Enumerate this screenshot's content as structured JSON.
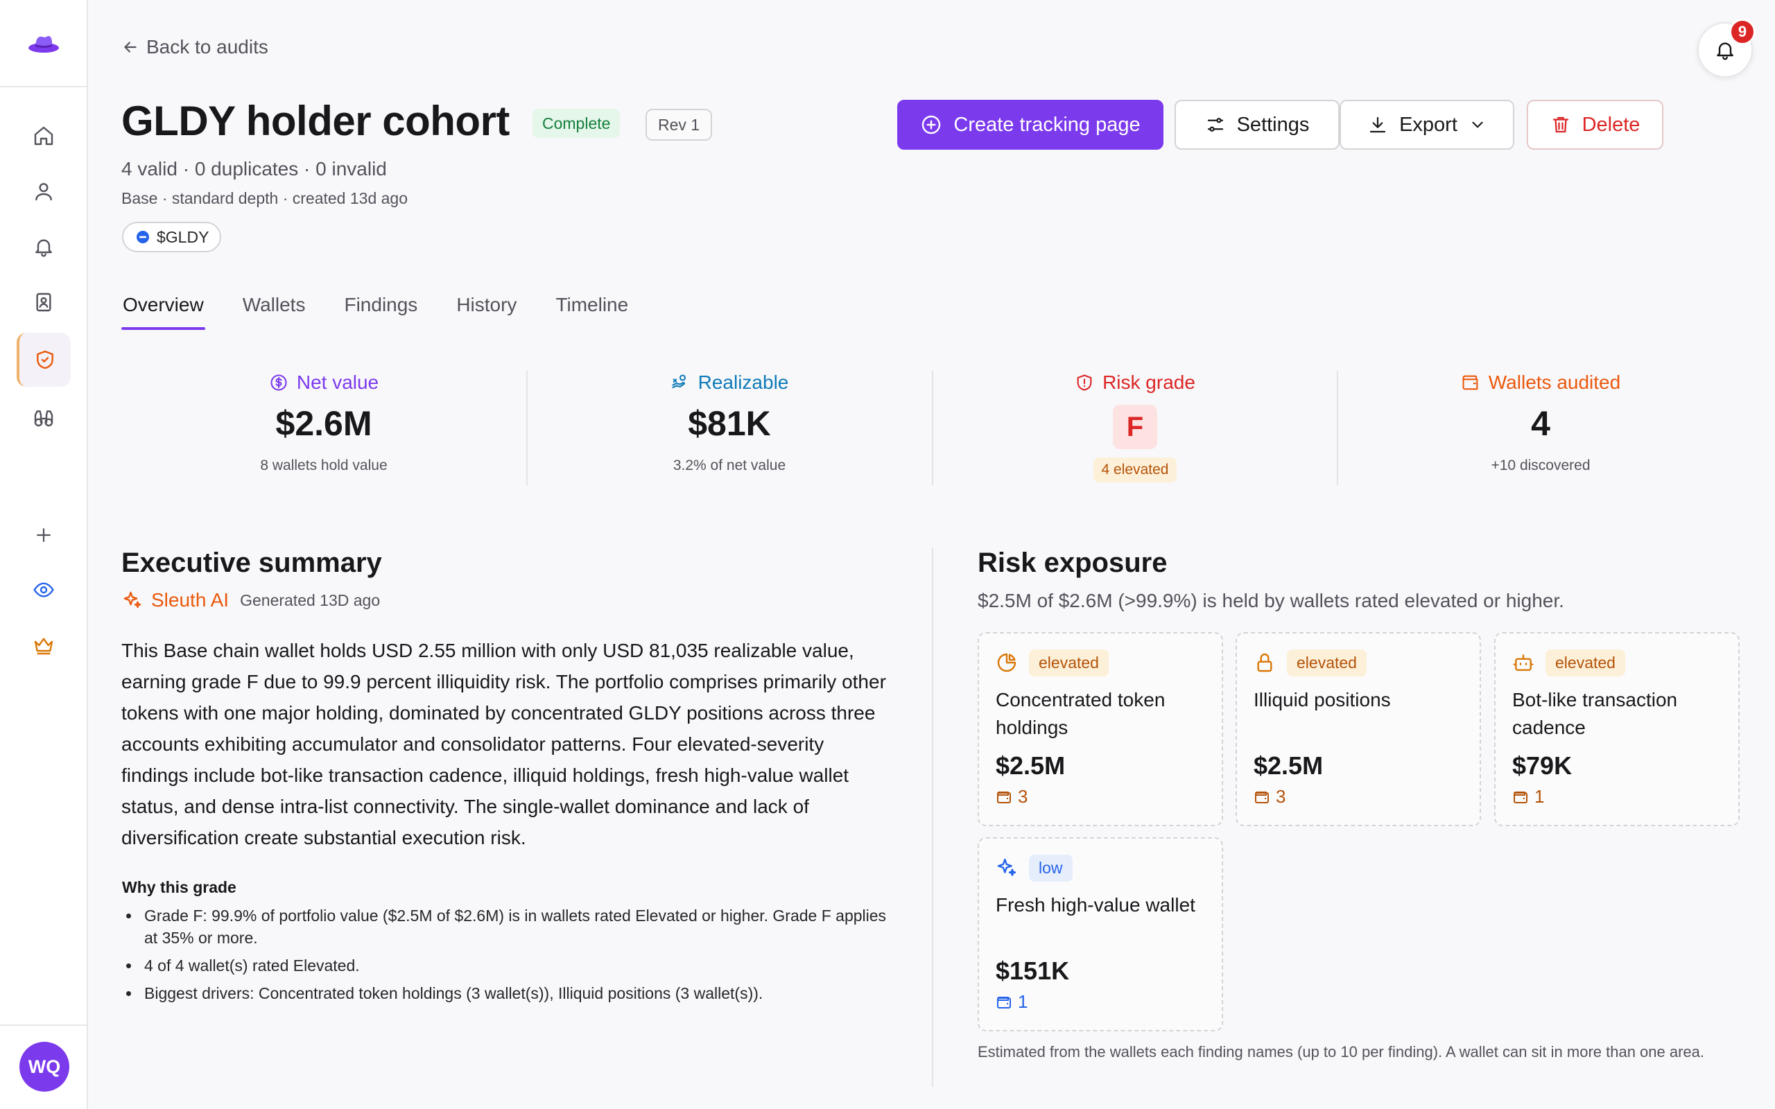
{
  "colors": {
    "accent": "#7c3aed",
    "danger": "#dc2626",
    "warning": "#b45309",
    "success": "#15803d",
    "info": "#2563eb",
    "net_value": "#7c3aed",
    "realizable": "#0e7ab8",
    "risk_grade": "#dc2626",
    "wallets_audited": "#ea580c"
  },
  "sidebar": {
    "items": [
      {
        "name": "home",
        "icon": "home-icon"
      },
      {
        "name": "profile",
        "icon": "user-icon"
      },
      {
        "name": "alerts",
        "icon": "bell-icon"
      },
      {
        "name": "contacts",
        "icon": "contact-book-icon"
      },
      {
        "name": "audits",
        "icon": "shield-check-icon",
        "active": true
      },
      {
        "name": "explore",
        "icon": "binoculars-icon"
      },
      {
        "name": "add",
        "icon": "plus-icon"
      },
      {
        "name": "watch",
        "icon": "eye-icon"
      },
      {
        "name": "premium",
        "icon": "crown-icon"
      }
    ],
    "avatar_initials": "WQ"
  },
  "header": {
    "back_label": "Back to audits",
    "title": "GLDY holder cohort",
    "status_badge": "Complete",
    "revision_badge": "Rev 1",
    "counts": "4 valid · 0 duplicates · 0 invalid",
    "meta": "Base · standard depth · created 13d ago",
    "token": "$GLDY",
    "notification_count": "9"
  },
  "actions": {
    "create": "Create tracking page",
    "settings": "Settings",
    "export": "Export",
    "delete": "Delete"
  },
  "tabs": [
    "Overview",
    "Wallets",
    "Findings",
    "History",
    "Timeline"
  ],
  "stats": {
    "net_value": {
      "label": "Net value",
      "value": "$2.6M",
      "sub": "8 wallets hold value"
    },
    "realizable": {
      "label": "Realizable",
      "value": "$81K",
      "sub": "3.2% of net value"
    },
    "risk_grade": {
      "label": "Risk grade",
      "value": "F",
      "sub": "4 elevated"
    },
    "wallets_audited": {
      "label": "Wallets audited",
      "value": "4",
      "sub": "+10 discovered"
    }
  },
  "summary": {
    "title": "Executive summary",
    "author": "Sleuth AI",
    "generated": "Generated 13D ago",
    "text": "This Base chain wallet holds USD 2.55 million with only USD 81,035 realizable value, earning grade F due to 99.9 percent illiquidity risk. The portfolio comprises primarily other tokens with one major holding, dominated by concentrated GLDY positions across three accounts exhibiting accumulator and consolidator patterns. Four elevated-severity findings include bot-like transaction cadence, illiquid holdings, fresh high-value wallet status, and dense intra-list connectivity. The single-wallet dominance and lack of diversification create substantial execution risk.",
    "why_title": "Why this grade",
    "why": [
      "Grade F: 99.9% of portfolio value ($2.5M of $2.6M) is in wallets rated Elevated or higher. Grade F applies at 35% or more.",
      "4 of 4 wallet(s) rated Elevated.",
      "Biggest drivers: Concentrated token holdings (3 wallet(s)), Illiquid positions (3 wallet(s))."
    ]
  },
  "risk": {
    "title": "Risk exposure",
    "subtitle": "$2.5M of $2.6M (>99.9%) is held by wallets rated elevated or higher.",
    "cards": [
      {
        "icon": "pie-chart-icon",
        "severity": "elevated",
        "name": "Concentrated token holdings",
        "amount": "$2.5M",
        "count": "3"
      },
      {
        "icon": "lock-icon",
        "severity": "elevated",
        "name": "Illiquid positions",
        "amount": "$2.5M",
        "count": "3"
      },
      {
        "icon": "bot-icon",
        "severity": "elevated",
        "name": "Bot-like transaction cadence",
        "amount": "$79K",
        "count": "1"
      },
      {
        "icon": "sparkles-icon",
        "severity": "low",
        "name": "Fresh high-value wallet",
        "amount": "$151K",
        "count": "1"
      }
    ],
    "footnote": "Estimated from the wallets each finding names (up to 10 per finding). A wallet can sit in more than one area."
  }
}
